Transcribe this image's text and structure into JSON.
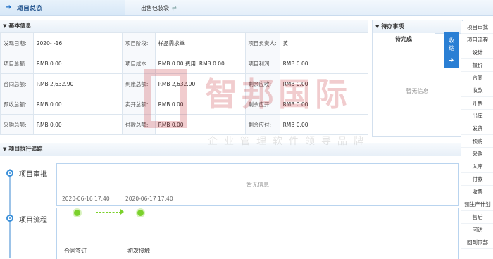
{
  "topbar": {
    "active_tab": "项目总览",
    "second_tab": "出售包装袋",
    "switch_icon": "swap-icon"
  },
  "basic": {
    "title": "基本信息",
    "rows": [
      [
        {
          "label": "发现日期:",
          "value": "2020-  -16"
        },
        {
          "label": "项目阶段:",
          "value": "样品需求单"
        },
        {
          "label": "项目负责人:",
          "value": "黄"
        }
      ],
      [
        {
          "label": "项目总额:",
          "value": "RMB 0.00"
        },
        {
          "label": "项目成本:",
          "value": "RMB 0.00  费用: RMB 0.00"
        },
        {
          "label": "项目利润:",
          "value": "RMB 0.00"
        }
      ],
      [
        {
          "label": "合同总额:",
          "value": "RMB 2,632.90"
        },
        {
          "label": "到账总额:",
          "value": "RMB 2,632.90"
        },
        {
          "label": "剩余应收:",
          "value": "RMB 0.00"
        }
      ],
      [
        {
          "label": "预收总额:",
          "value": "RMB 0.00"
        },
        {
          "label": "实开总额:",
          "value": "RMB 0.00"
        },
        {
          "label": "剩余应开:",
          "value": "RMB 0.00"
        }
      ],
      [
        {
          "label": "采购总额:",
          "value": "RMB 0.00"
        },
        {
          "label": "付款总额:",
          "value": "RMB 0.00"
        },
        {
          "label": "剩余应付:",
          "value": "RMB 0.00"
        }
      ]
    ]
  },
  "pending": {
    "title": "待办事项",
    "tab": "待完成",
    "empty": "暂无信息",
    "collapse": "收缩"
  },
  "side_menu": [
    "项目审批",
    "项目流程",
    "设计",
    "报价",
    "合同",
    "收款",
    "开票",
    "出库",
    "发货",
    "预购",
    "采购",
    "入库",
    "付款",
    "收票",
    "预生产计划",
    "售后",
    "回访",
    "回到顶部"
  ],
  "tracking": {
    "title": "项目执行追踪",
    "nodes": [
      {
        "label": "项目审批",
        "empty": "暂无信息"
      },
      {
        "label": "项目流程"
      }
    ],
    "steps": [
      {
        "date": "2020-06-16 17:40",
        "name": "合同签订"
      },
      {
        "date": "2020-06-17 17:40",
        "name": "初次接触"
      }
    ]
  },
  "watermark": {
    "title": "智邦国际",
    "subtitle": "企业管理软件领导品牌"
  }
}
